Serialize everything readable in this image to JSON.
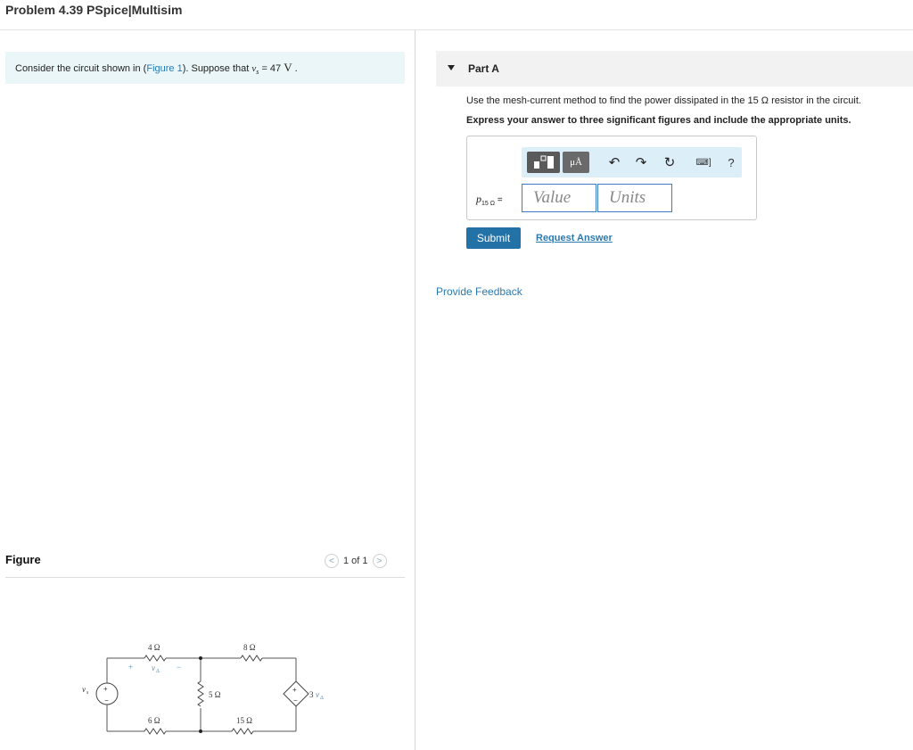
{
  "header": {
    "title": "Problem 4.39 PSpice|Multisim"
  },
  "intro": {
    "text_before": "Consider the circuit shown in (",
    "figure_link": "Figure 1",
    "text_after": "). Suppose that ",
    "var": "v",
    "var_sub": "s",
    "equals": " = 47 ",
    "unit": "V",
    "period": " ."
  },
  "figure": {
    "label": "Figure",
    "pager": {
      "prev": "<",
      "text": "1 of 1",
      "next": ">"
    },
    "circuit": {
      "r1": "4 Ω",
      "r2": "8 Ω",
      "r3": "5 Ω",
      "r4": "6 Ω",
      "r5": "15 Ω",
      "source": "v",
      "source_sub": "s",
      "vdelta": "v",
      "vdelta_sub": "Δ",
      "plus": "+",
      "minus": "−",
      "dep_gain": "3 ",
      "dep_var": "v",
      "dep_sub": "Δ"
    }
  },
  "part": {
    "title": "Part A",
    "question": "Use the mesh-current method to find the power dissipated in the 15 Ω resistor in the circuit.",
    "instruction": "Express your answer to three significant figures and include the appropriate units.",
    "answer": {
      "label_var": "p",
      "label_sub": "15 Ω",
      "label_eq": " =",
      "value_placeholder": "Value",
      "units_placeholder": "Units"
    },
    "toolbar": {
      "units_text": "μÅ",
      "undo": "↶",
      "redo": "↷",
      "reset": "↻",
      "keyboard": "⌨]",
      "help": "?"
    },
    "submit_label": "Submit",
    "request_label": "Request Answer"
  },
  "feedback": {
    "label": "Provide Feedback"
  },
  "colors": {
    "accent": "#2272a8",
    "link": "#2a7ab0",
    "intro_bg": "#eaf6f8",
    "toolbar_bg": "#dceef8"
  }
}
